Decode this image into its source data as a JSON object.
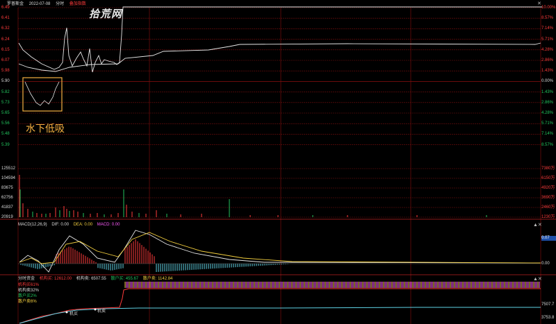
{
  "header": {
    "stock_name": "罗普斯金",
    "date": "2022-07-08",
    "mode": "分时",
    "overlay": "叠加指数",
    "close_icon": "close-icon"
  },
  "watermark": "拾荒网",
  "annotation": "水下低吸",
  "price_axis": {
    "left_labels": [
      "6.49",
      "6.41",
      "6.32",
      "6.24",
      "6.15",
      "6.07",
      "5.98",
      "5.90",
      "5.82",
      "5.73",
      "5.65",
      "5.56",
      "5.48",
      "5.39"
    ],
    "right_labels": [
      "10.00%",
      "8.57%",
      "7.14%",
      "5.71%",
      "4.28%",
      "2.86%",
      "1.43%",
      "0.00%",
      "1.43%",
      "2.86%",
      "4.28%",
      "5.71%",
      "7.14%",
      "8.57%"
    ]
  },
  "volume_axis": {
    "left_labels": [
      "125512",
      "104594",
      "83675",
      "62756",
      "41837",
      "20919"
    ],
    "right_labels": [
      "7380万",
      "6150万",
      "4920万",
      "3690万",
      "2460万",
      "1230万"
    ]
  },
  "macd": {
    "label": "MACD(12,26,9)",
    "dif": "DIF: 0.00",
    "dea": "DEA: 0.00",
    "macd": "MACD: 0.00",
    "right_value": "0.07",
    "right_zero": "0.00"
  },
  "fund_flow": {
    "title": "分时资金",
    "main_net": "机构买: 12612.00",
    "inst_sell": "机构卖: 6507.55",
    "retail_buy": "散户买: 455.67",
    "retail_sell": "散户卖: 1142.84",
    "legend": [
      "机构买61%",
      "机构卖32%",
      "散户买2%",
      "散户卖6%"
    ],
    "right_values": [
      "7507.7",
      "3753.8"
    ],
    "markers": [
      "机买",
      "机卖"
    ]
  },
  "colors": {
    "up": "#ff3b3b",
    "down": "#22c55e",
    "price_line": "#e8e8e8",
    "grid": "#7a0e0e",
    "annotation": "#f5b041",
    "macd_yellow": "#f4d03f",
    "macd_magenta": "#ff5cff",
    "macd_white": "#e8e8e8"
  }
}
